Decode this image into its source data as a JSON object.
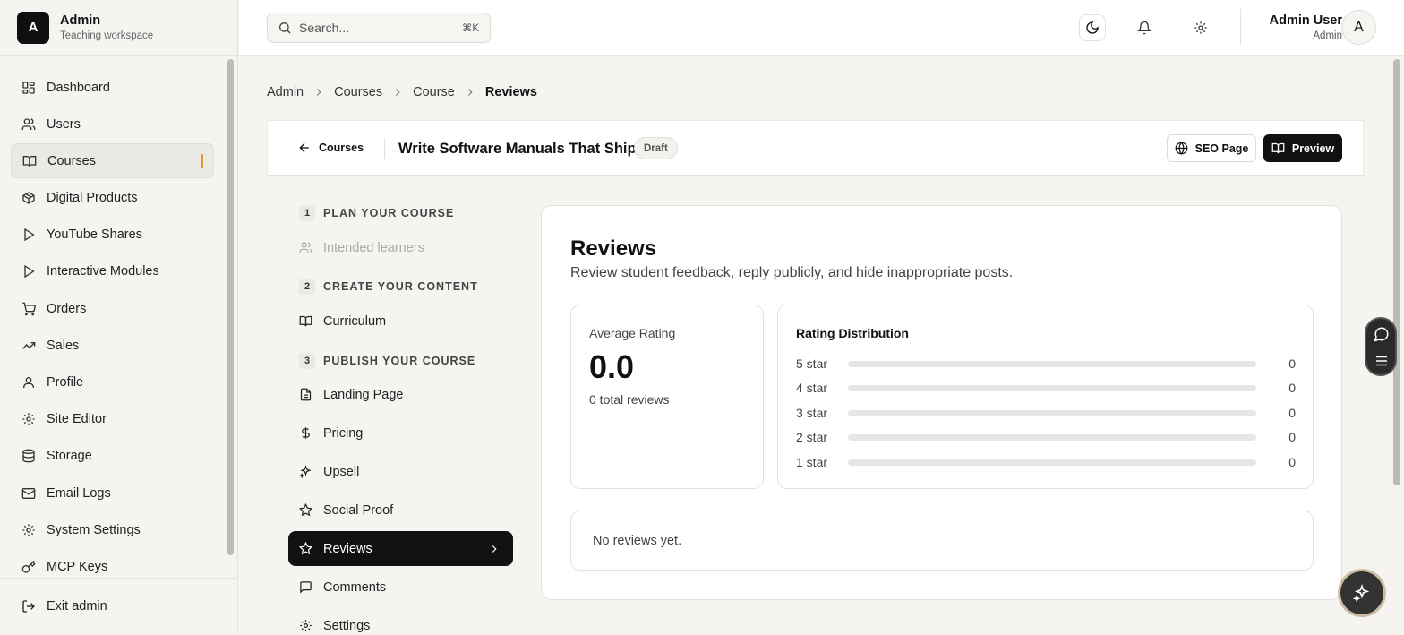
{
  "brand": {
    "logo_letter": "A",
    "title": "Admin",
    "subtitle": "Teaching workspace"
  },
  "sidebar": {
    "items": [
      {
        "label": "Dashboard",
        "icon": "layout-dashboard-icon"
      },
      {
        "label": "Users",
        "icon": "users-icon"
      },
      {
        "label": "Courses",
        "icon": "book-open-icon",
        "active": true
      },
      {
        "label": "Digital Products",
        "icon": "package-icon"
      },
      {
        "label": "YouTube Shares",
        "icon": "play-icon"
      },
      {
        "label": "Interactive Modules",
        "icon": "play-icon"
      },
      {
        "label": "Orders",
        "icon": "shopping-cart-icon"
      },
      {
        "label": "Sales",
        "icon": "trending-up-icon"
      },
      {
        "label": "Profile",
        "icon": "user-icon"
      },
      {
        "label": "Site Editor",
        "icon": "gear-icon"
      },
      {
        "label": "Storage",
        "icon": "database-icon"
      },
      {
        "label": "Email Logs",
        "icon": "mail-icon"
      },
      {
        "label": "System Settings",
        "icon": "gear-icon"
      },
      {
        "label": "MCP Keys",
        "icon": "key-icon"
      }
    ],
    "exit_label": "Exit admin"
  },
  "topbar": {
    "search_placeholder": "Search...",
    "search_shortcut": "⌘K",
    "user_name": "Admin User",
    "user_role": "Admin",
    "avatar_letter": "A"
  },
  "breadcrumb": [
    "Admin",
    "Courses",
    "Course",
    "Reviews"
  ],
  "course": {
    "back_label": "Courses",
    "title": "Write Software Manuals That Ship",
    "status": "Draft",
    "seo_label": "SEO Page",
    "preview_label": "Preview"
  },
  "steps": {
    "s1": {
      "num": "1",
      "title": "PLAN YOUR COURSE"
    },
    "s1_items": [
      {
        "label": "Intended learners"
      }
    ],
    "s2": {
      "num": "2",
      "title": "CREATE YOUR CONTENT"
    },
    "s2_items": [
      {
        "label": "Curriculum"
      }
    ],
    "s3": {
      "num": "3",
      "title": "PUBLISH YOUR COURSE"
    },
    "s3_items": [
      {
        "label": "Landing Page"
      },
      {
        "label": "Pricing"
      },
      {
        "label": "Upsell"
      },
      {
        "label": "Social Proof"
      },
      {
        "label": "Reviews",
        "active": true
      },
      {
        "label": "Comments"
      },
      {
        "label": "Settings"
      }
    ]
  },
  "reviews": {
    "title": "Reviews",
    "subtitle": "Review student feedback, reply publicly, and hide inappropriate posts.",
    "avg_label": "Average Rating",
    "avg_value": "0.0",
    "total_label": "0 total reviews",
    "dist_title": "Rating Distribution",
    "distribution": [
      {
        "label": "5 star",
        "count": "0",
        "fraction": 0
      },
      {
        "label": "4 star",
        "count": "0",
        "fraction": 0
      },
      {
        "label": "3 star",
        "count": "0",
        "fraction": 0
      },
      {
        "label": "2 star",
        "count": "0",
        "fraction": 0
      },
      {
        "label": "1 star",
        "count": "0",
        "fraction": 0
      }
    ],
    "empty_text": "No reviews yet."
  },
  "colors": {
    "accent": "#d89a2c",
    "dark": "#111111",
    "background": "#f5f4f1"
  }
}
